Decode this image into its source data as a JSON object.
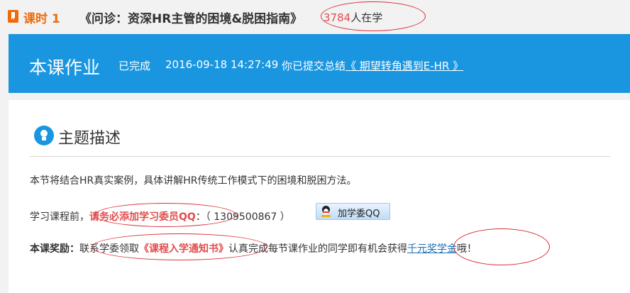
{
  "header": {
    "lesson_label": "课时 1",
    "course_title": "《问诊：资深HR主管的困境&脱困指南》",
    "learner_count": "3784",
    "learner_suffix": "人在学"
  },
  "banner": {
    "title": "本课作业",
    "status": "已完成",
    "timestamp": "2016-09-18 14:27:49",
    "summary_prefix": "你已提交总结",
    "summary_link": "《 期望转角遇到E-HR 》"
  },
  "topic": {
    "heading": "主题描述",
    "description": "本节将结合HR真实案例，具体讲解HR传统工作模式下的困境和脱困方法。",
    "line2_prefix": "学习课程前，",
    "line2_emphasis": "请务必添加学习委员QQ",
    "line2_number": "：（ 1309500867 ）",
    "qq_button_label": "加学委QQ",
    "reward_label": "本课奖励：",
    "reward_text1": "联系学委领取",
    "reward_emphasis": "《课程入学通知书》",
    "reward_text2": "认真完成每节课作业的同学即有机会获得",
    "reward_link": "千元奖学金",
    "reward_suffix": "哦！"
  },
  "colors": {
    "accent_orange": "#ee6b0c",
    "banner_blue": "#1a96e0",
    "emphasis_red": "#e14d4d",
    "annotation_red": "#d9303a"
  },
  "icons": [
    "bookmark-icon",
    "lightbulb-icon",
    "qq-penguin-icon"
  ]
}
